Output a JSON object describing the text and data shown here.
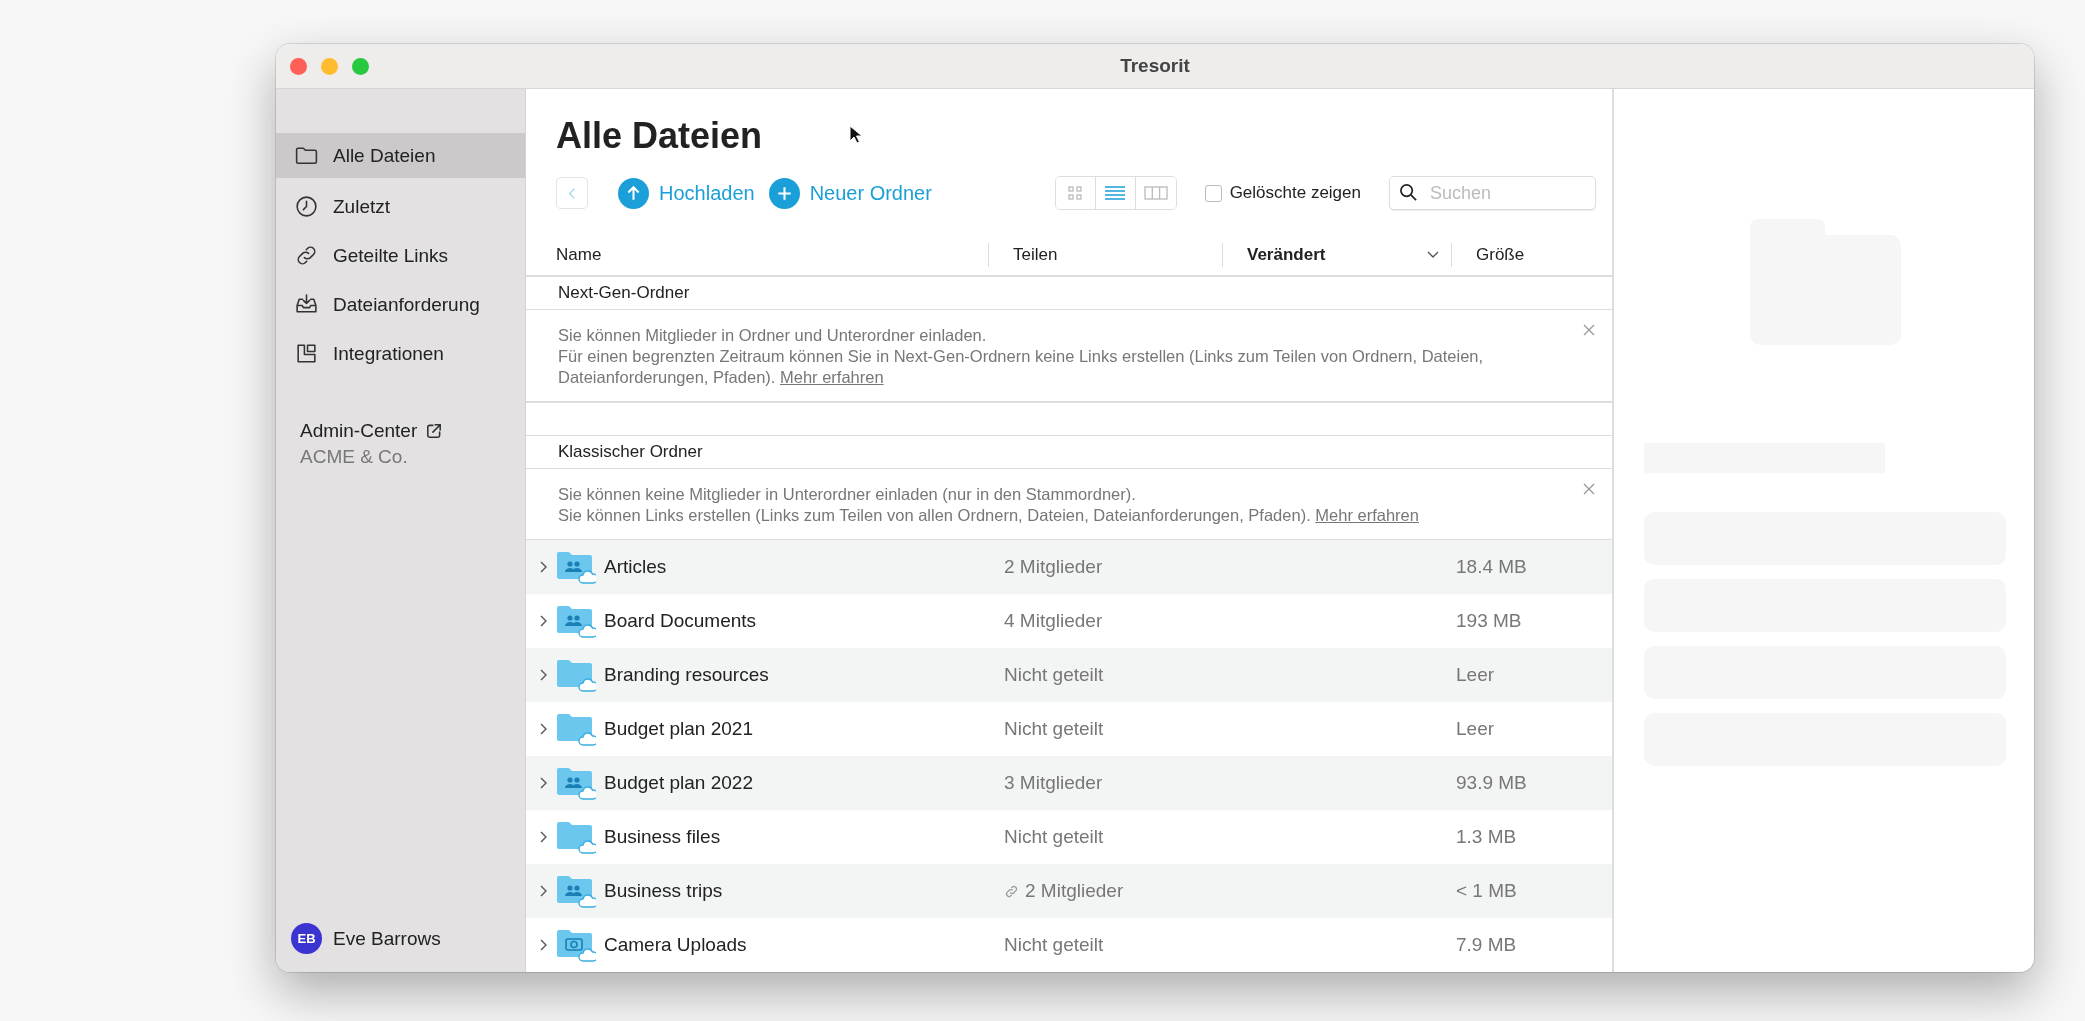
{
  "window": {
    "title": "Tresorit"
  },
  "sidebar": {
    "items": [
      {
        "label": "Alle Dateien",
        "kind": "folder",
        "selected": true
      },
      {
        "label": "Zuletzt",
        "kind": "clock",
        "selected": false
      },
      {
        "label": "Geteilte Links",
        "kind": "link",
        "selected": false
      },
      {
        "label": "Dateianforderung",
        "kind": "inbox",
        "selected": false
      },
      {
        "label": "Integrationen",
        "kind": "integrations",
        "selected": false
      }
    ],
    "admin": {
      "label": "Admin-Center",
      "company": "ACME & Co."
    },
    "user": {
      "initials": "EB",
      "name": "Eve Barrows"
    }
  },
  "main": {
    "title": "Alle Dateien",
    "toolbar": {
      "upload": "Hochladen",
      "new_folder": "Neuer Ordner",
      "views": [
        {
          "kind": "grid",
          "selected": false
        },
        {
          "kind": "list",
          "selected": true
        },
        {
          "kind": "columns",
          "selected": false
        }
      ],
      "show_deleted": {
        "label": "Gelöschte zeigen",
        "checked": false
      },
      "search": {
        "placeholder": "Suchen"
      }
    },
    "columns": [
      {
        "label": "Name",
        "sorted": false
      },
      {
        "label": "Teilen",
        "sorted": false
      },
      {
        "label": "Verändert",
        "sorted": true
      },
      {
        "label": "Größe",
        "sorted": false
      }
    ],
    "sections": [
      {
        "title": "Next-Gen-Ordner",
        "notice": {
          "lines": [
            "Sie können Mitglieder in Ordner und Unterordner einladen.",
            "Für einen begrenzten Zeitraum können Sie in Next-Gen-Ordnern keine Links erstellen (Links zum Teilen von Ordnern, Dateien, Dateianforderungen, Pfaden)."
          ],
          "link": "Mehr erfahren"
        }
      },
      {
        "title": "Klassischer Ordner",
        "notice": {
          "lines": [
            "Sie können keine Mitglieder in Unterordner einladen (nur in den Stammordner).",
            "Sie können Links erstellen (Links zum Teilen von allen Ordnern, Dateien, Dateianforderungen, Pfaden)."
          ],
          "link": "Mehr erfahren"
        },
        "rows": [
          {
            "name": "Articles",
            "kind": "shared",
            "sharing": "2 Mitglieder",
            "link": false,
            "size": "18.4 MB"
          },
          {
            "name": "Board Documents",
            "kind": "shared",
            "sharing": "4 Mitglieder",
            "link": false,
            "size": "193 MB"
          },
          {
            "name": "Branding resources",
            "kind": "plain",
            "sharing": "Nicht geteilt",
            "link": false,
            "size": "Leer"
          },
          {
            "name": "Budget plan 2021",
            "kind": "plain",
            "sharing": "Nicht geteilt",
            "link": false,
            "size": "Leer"
          },
          {
            "name": "Budget plan 2022",
            "kind": "shared",
            "sharing": "3 Mitglieder",
            "link": false,
            "size": "93.9 MB"
          },
          {
            "name": "Business files",
            "kind": "plain",
            "sharing": "Nicht geteilt",
            "link": false,
            "size": "1.3 MB"
          },
          {
            "name": "Business trips",
            "kind": "shared",
            "sharing": "2 Mitglieder",
            "link": true,
            "size": "< 1 MB"
          },
          {
            "name": "Camera Uploads",
            "kind": "camera",
            "sharing": "Nicht geteilt",
            "link": false,
            "size": "7.9 MB"
          }
        ]
      }
    ]
  }
}
